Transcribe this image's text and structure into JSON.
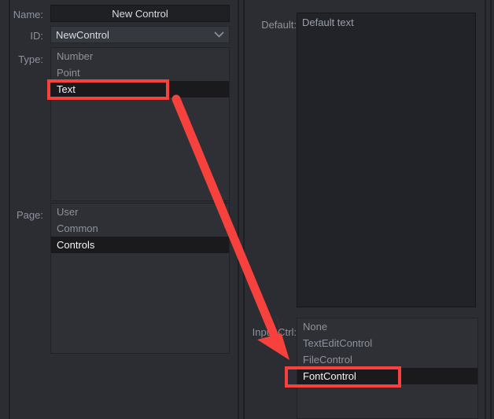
{
  "form": {
    "name": {
      "label": "Name:",
      "value": "New Control"
    },
    "id": {
      "label": "ID:",
      "value": "NewControl"
    },
    "type": {
      "label": "Type:",
      "options": [
        "Number",
        "Point",
        "Text"
      ],
      "selected": "Text"
    },
    "page": {
      "label": "Page:",
      "options": [
        "User",
        "Common",
        "Controls"
      ],
      "selected": "Controls"
    },
    "default": {
      "label": "Default:",
      "value": "Default text"
    },
    "input_ctrl": {
      "label": "Input Ctrl:",
      "options": [
        "None",
        "TextEditControl",
        "FileControl",
        "FontControl"
      ],
      "selected": "FontControl"
    }
  },
  "annotations": {
    "highlight_color": "#f7413c",
    "arrow_color": "#f7413c",
    "highlighted_items": [
      "Text",
      "FontControl"
    ]
  }
}
